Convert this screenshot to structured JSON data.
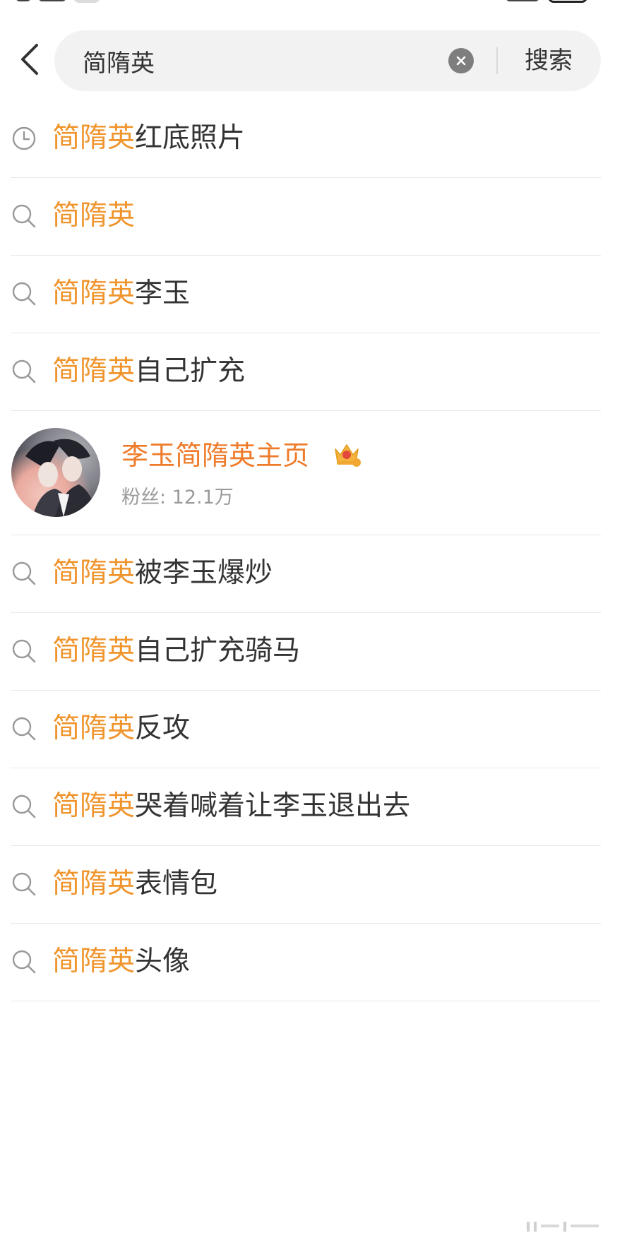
{
  "search": {
    "query": "简隋英",
    "submit_label": "搜索"
  },
  "suggestions_top": [
    {
      "icon": "history-clock-icon",
      "highlight": "简隋英",
      "rest": "红底照片"
    },
    {
      "icon": "search-icon",
      "highlight": "简隋英",
      "rest": ""
    },
    {
      "icon": "search-icon",
      "highlight": "简隋英",
      "rest": "李玉"
    },
    {
      "icon": "search-icon",
      "highlight": "简隋英",
      "rest": "自己扩充"
    }
  ],
  "user_card": {
    "name": "李玉简隋英主页",
    "fans": "粉丝: 12.1万",
    "badge_icon": "crown-badge-icon"
  },
  "suggestions_bottom": [
    {
      "icon": "search-icon",
      "highlight": "简隋英",
      "rest": "被李玉爆炒"
    },
    {
      "icon": "search-icon",
      "highlight": "简隋英",
      "rest": "自己扩充骑马"
    },
    {
      "icon": "search-icon",
      "highlight": "简隋英",
      "rest": "反攻"
    },
    {
      "icon": "search-icon",
      "highlight": "简隋英",
      "rest": "哭着喊着让李玉退出去"
    },
    {
      "icon": "search-icon",
      "highlight": "简隋英",
      "rest": "表情包"
    },
    {
      "icon": "search-icon",
      "highlight": "简隋英",
      "rest": "头像"
    }
  ],
  "colors": {
    "highlight": "#f0952d",
    "user_name": "#ee7b2a",
    "text": "#333333",
    "muted": "#9a9a9a",
    "search_bg": "#f2f2f2"
  }
}
